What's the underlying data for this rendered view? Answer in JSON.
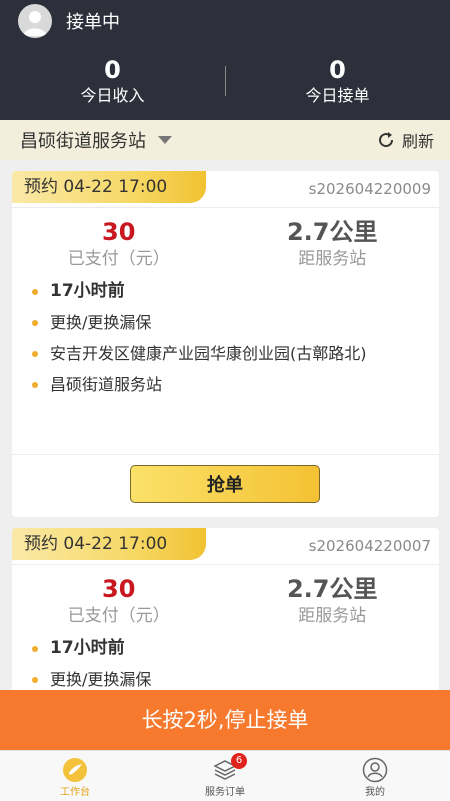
{
  "header": {
    "status": "接单中",
    "stats": [
      {
        "value": "0",
        "label": "今日收入"
      },
      {
        "value": "0",
        "label": "今日接单"
      }
    ]
  },
  "station": {
    "name": "昌硕街道服务站",
    "refresh_label": "刷新"
  },
  "orders": [
    {
      "appointment": "预约 04-22 17:00",
      "order_no": "s202604220009",
      "price": "30",
      "price_label": "已支付（元）",
      "distance": "2.7公里",
      "distance_label": "距服务站",
      "time_ago": "17小时前",
      "service": "更换/更换漏保",
      "address": "安吉开发区健康产业园华康创业园(古鄣路北)",
      "station": "昌硕街道服务站",
      "grab_label": "抢单"
    },
    {
      "appointment": "预约 04-22 17:00",
      "order_no": "s202604220007",
      "price": "30",
      "price_label": "已支付（元）",
      "distance": "2.7公里",
      "distance_label": "距服务站",
      "time_ago": "17小时前",
      "service": "更换/更换漏保"
    }
  ],
  "stop_button": "长按2秒,停止接单",
  "tabs": [
    {
      "label": "工作台",
      "icon": "workbench-icon",
      "active": true
    },
    {
      "label": "服务订单",
      "icon": "orders-icon",
      "badge": "6"
    },
    {
      "label": "我的",
      "icon": "profile-icon"
    }
  ],
  "colors": {
    "header_bg": "#2d303b",
    "accent_orange": "#f6792e",
    "price_red": "#c8171e",
    "tag_gold": "#f6d761"
  }
}
